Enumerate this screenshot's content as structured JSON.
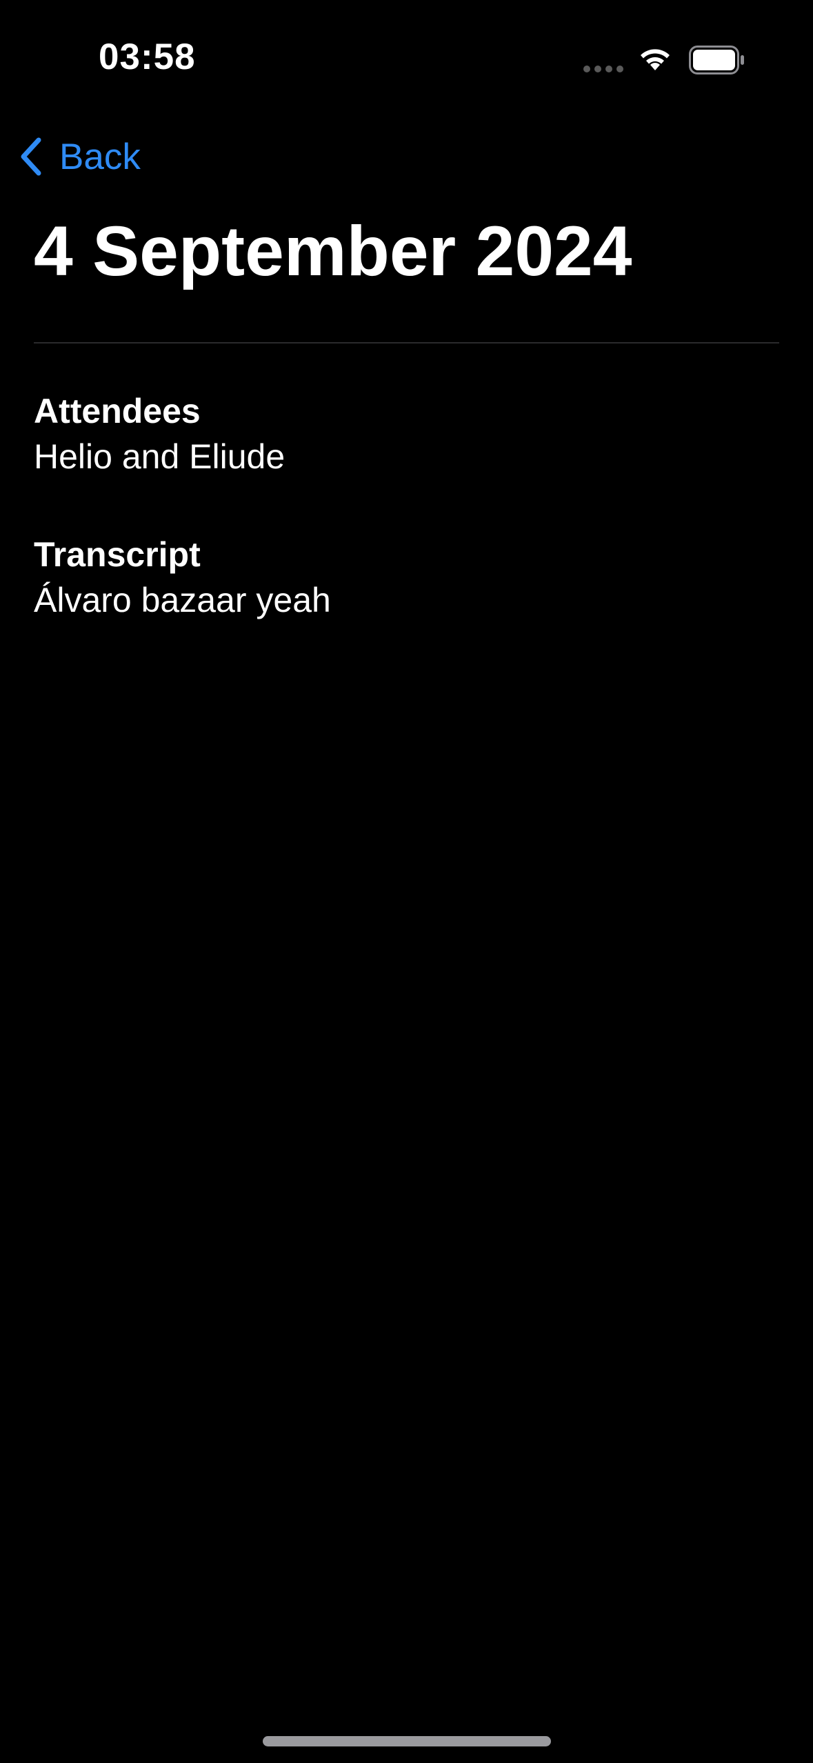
{
  "status_bar": {
    "time": "03:58"
  },
  "nav": {
    "back_label": "Back"
  },
  "page": {
    "title": "4 September 2024"
  },
  "sections": {
    "attendees": {
      "heading": "Attendees",
      "value": "Helio and Eliude"
    },
    "transcript": {
      "heading": "Transcript",
      "value": "Álvaro bazaar yeah"
    }
  },
  "colors": {
    "background": "#000000",
    "accent": "#2f8bf5",
    "text": "#ffffff",
    "divider": "#2a2a2c"
  },
  "icons": [
    "wifi-icon",
    "battery-icon",
    "cellular-signal-icon",
    "back-chevron-icon"
  ]
}
